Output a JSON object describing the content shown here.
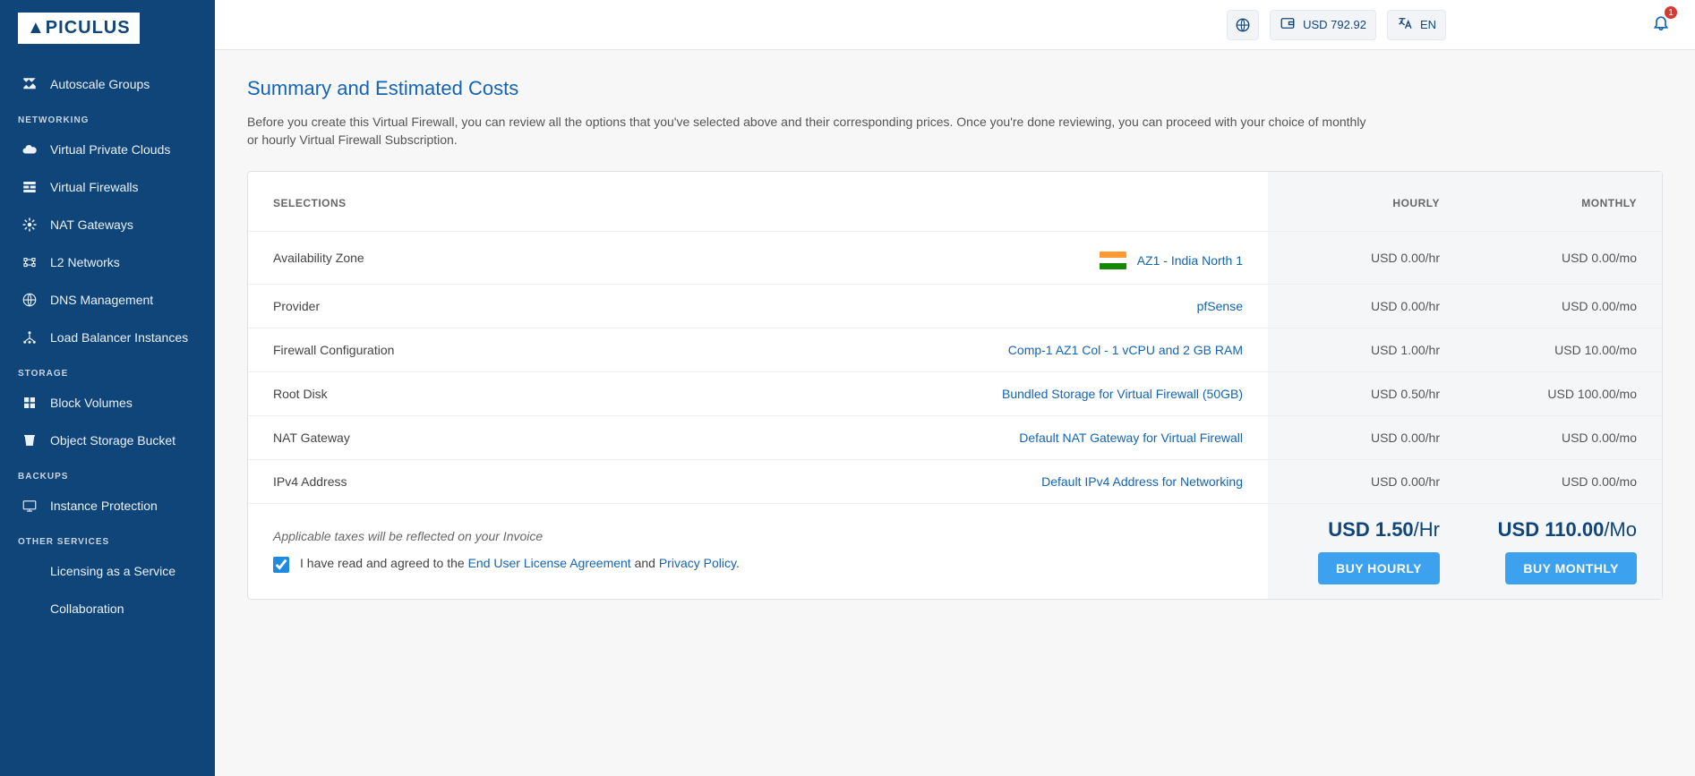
{
  "brand": "▲PICULUS",
  "topbar": {
    "balance_label": "USD 792.92",
    "lang_label": "EN",
    "notif_count": "1"
  },
  "sidebar": {
    "item_autoscale": "Autoscale Groups",
    "section_networking": "NETWORKING",
    "item_vpc": "Virtual Private Clouds",
    "item_vfw": "Virtual Firewalls",
    "item_nat": "NAT Gateways",
    "item_l2": "L2 Networks",
    "item_dns": "DNS Management",
    "item_lb": "Load Balancer Instances",
    "section_storage": "STORAGE",
    "item_block": "Block Volumes",
    "item_object": "Object Storage Bucket",
    "section_backups": "BACKUPS",
    "item_instprot": "Instance Protection",
    "section_other": "OTHER SERVICES",
    "item_laas": "Licensing as a Service",
    "item_collab": "Collaboration"
  },
  "page": {
    "title": "Summary and Estimated Costs",
    "desc": "Before you create this Virtual Firewall, you can review all the options that you've selected above and their corresponding prices. Once you're done reviewing, you can proceed with your choice of monthly or hourly Virtual Firewall Subscription."
  },
  "table": {
    "head_selections": "SELECTIONS",
    "head_hourly": "HOURLY",
    "head_monthly": "MONTHLY",
    "rows": [
      {
        "name": "Availability Zone",
        "value": "AZ1 - India North 1",
        "hourly": "USD 0.00/hr",
        "monthly": "USD 0.00/mo",
        "flag": true
      },
      {
        "name": "Provider",
        "value": "pfSense",
        "hourly": "USD 0.00/hr",
        "monthly": "USD 0.00/mo"
      },
      {
        "name": "Firewall Configuration",
        "value": "Comp-1 AZ1 Col - 1 vCPU and 2 GB RAM",
        "hourly": "USD 1.00/hr",
        "monthly": "USD 10.00/mo"
      },
      {
        "name": "Root Disk",
        "value": "Bundled Storage for Virtual Firewall (50GB)",
        "hourly": "USD 0.50/hr",
        "monthly": "USD 100.00/mo"
      },
      {
        "name": "NAT Gateway",
        "value": "Default NAT Gateway for Virtual Firewall",
        "hourly": "USD 0.00/hr",
        "monthly": "USD 0.00/mo"
      },
      {
        "name": "IPv4 Address",
        "value": "Default IPv4 Address for Networking",
        "hourly": "USD 0.00/hr",
        "monthly": "USD 0.00/mo"
      }
    ]
  },
  "totals": {
    "tax_note": "Applicable taxes will be reflected on your Invoice",
    "agree_pre": "I have read and agreed to the ",
    "eula": "End User License Agreement",
    "agree_mid": " and ",
    "privacy": "Privacy Policy",
    "agree_end": ".",
    "hourly_amt": "USD 1.50",
    "hourly_per": "/Hr",
    "monthly_amt": "USD 110.00",
    "monthly_per": "/Mo",
    "buy_hourly_label": "BUY HOURLY",
    "buy_monthly_label": "BUY MONTHLY"
  }
}
